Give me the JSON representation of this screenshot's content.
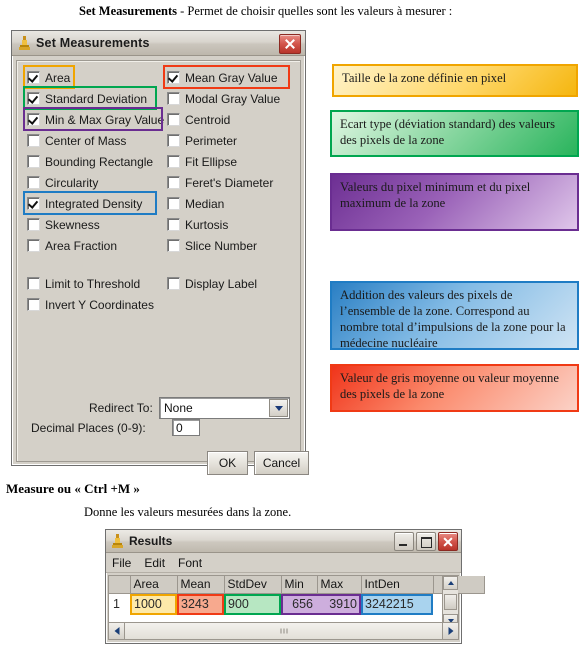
{
  "document": {
    "intro_bold": "Set Measurements",
    "intro_rest": " - Permet de choisir quelles sont les valeurs à mesurer :",
    "measure_heading": "Measure ou « Ctrl +M »",
    "measure_sub": "Donne les valeurs mesurées dans la zone."
  },
  "set_measurements_dialog": {
    "title": "Set Measurements",
    "icon": "microscope-icon",
    "close_icon": "close-icon",
    "left_column": [
      {
        "label": "Area",
        "checked": true,
        "highlight": "#f0a500"
      },
      {
        "label": "Standard Deviation",
        "checked": true,
        "highlight": "#00a650"
      },
      {
        "label": "Min & Max Gray Value",
        "checked": true,
        "highlight": "#6a2d91"
      },
      {
        "label": "Center of Mass",
        "checked": false,
        "highlight": null
      },
      {
        "label": "Bounding Rectangle",
        "checked": false,
        "highlight": null
      },
      {
        "label": "Circularity",
        "checked": false,
        "highlight": null
      },
      {
        "label": "Integrated Density",
        "checked": true,
        "highlight": "#1f7cc4"
      },
      {
        "label": "Skewness",
        "checked": false,
        "highlight": null
      },
      {
        "label": "Area Fraction",
        "checked": false,
        "highlight": null
      }
    ],
    "right_column": [
      {
        "label": "Mean Gray Value",
        "checked": true,
        "highlight": "#f03a15"
      },
      {
        "label": "Modal Gray Value",
        "checked": false,
        "highlight": null
      },
      {
        "label": "Centroid",
        "checked": false,
        "highlight": null
      },
      {
        "label": "Perimeter",
        "checked": false,
        "highlight": null
      },
      {
        "label": "Fit Ellipse",
        "checked": false,
        "highlight": null
      },
      {
        "label": "Feret's Diameter",
        "checked": false,
        "highlight": null
      },
      {
        "label": "Median",
        "checked": false,
        "highlight": null
      },
      {
        "label": "Kurtosis",
        "checked": false,
        "highlight": null
      },
      {
        "label": "Slice Number",
        "checked": false,
        "highlight": null
      }
    ],
    "options": [
      {
        "label": "Limit to Threshold",
        "checked": false
      },
      {
        "label": "Display Label",
        "checked": false
      },
      {
        "label": "Invert Y Coordinates",
        "checked": false
      }
    ],
    "redirect": {
      "label": "Redirect To:",
      "value": "None",
      "dropdown_icon": "chevron-down-icon"
    },
    "decimal_places": {
      "label": "Decimal Places (0-9):",
      "value": "0"
    },
    "buttons": {
      "ok": "OK",
      "cancel": "Cancel"
    }
  },
  "callouts": [
    {
      "id": "area",
      "text": "Taille de la zone définie en pixel",
      "color": "#f0a500"
    },
    {
      "id": "stddev",
      "text": "Ecart type (déviation standard) des valeurs des pixels de la zone",
      "color": "#00a650"
    },
    {
      "id": "minmax",
      "text": "Valeurs du pixel minimum et du pixel maximum de la zone",
      "color": "#6a2d91"
    },
    {
      "id": "intden",
      "text": "Addition des valeurs des pixels de l’ensemble de la zone. Correspond au nombre total d’impulsions de la zone pour la médecine nucléaire",
      "color": "#1f7cc4"
    },
    {
      "id": "mean",
      "text": "Valeur de gris moyenne ou valeur moyenne des pixels de la zone",
      "color": "#f03a15"
    }
  ],
  "results_window": {
    "title": "Results",
    "icon": "microscope-icon",
    "window_buttons": {
      "minimize": "minimize-icon",
      "maximize": "maximize-icon",
      "close": "close-icon"
    },
    "menu": [
      "File",
      "Edit",
      "Font"
    ],
    "table": {
      "columns": [
        "",
        "Area",
        "Mean",
        "StdDev",
        "Min",
        "Max",
        "IntDen",
        ""
      ],
      "rows": [
        {
          "index": "1",
          "Area": "1000",
          "Mean": "3243",
          "StdDev": "900",
          "Min": "656",
          "Max": "3910",
          "IntDen": "3242215"
        }
      ]
    }
  }
}
